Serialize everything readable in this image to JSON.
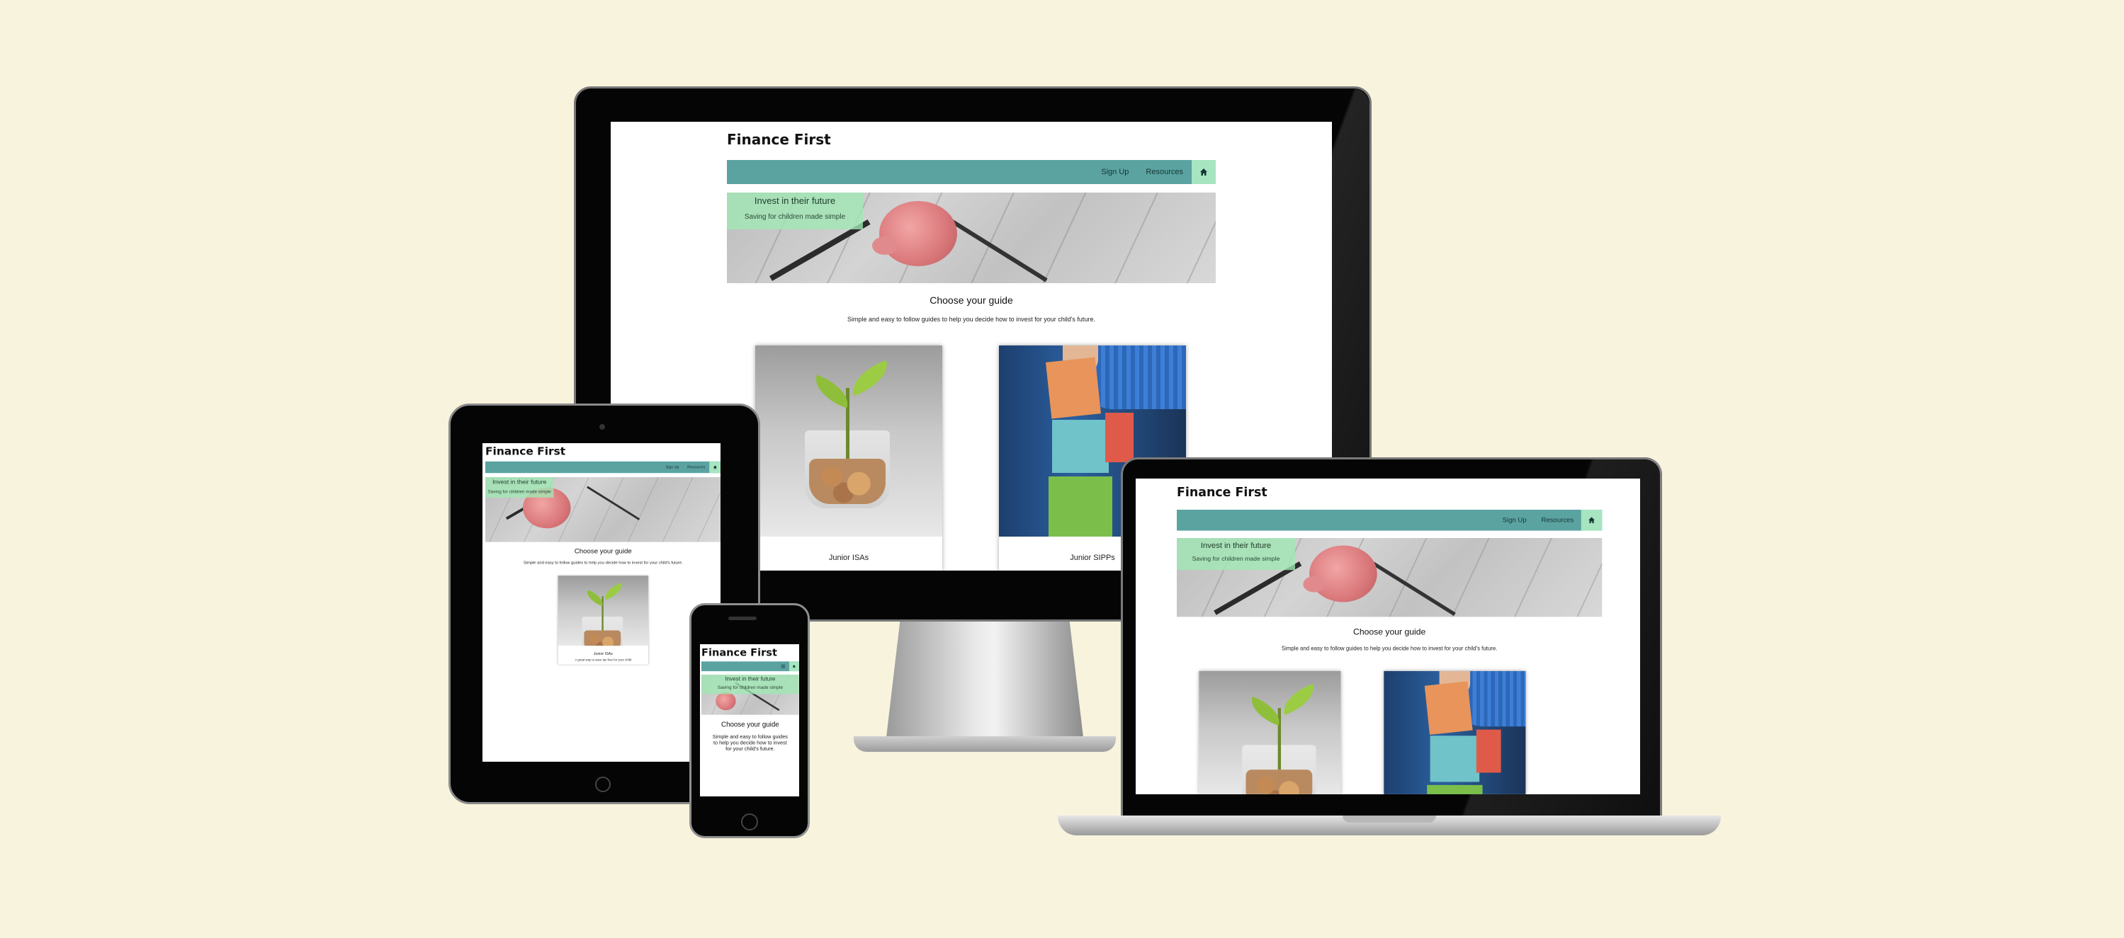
{
  "site": {
    "title": "Finance First",
    "nav": {
      "signup": "Sign Up",
      "resources": "Resources",
      "home_icon": "home-icon",
      "menu_icon": "hamburger-icon"
    },
    "hero": {
      "heading": "Invest in their future",
      "subheading": "Saving for children made simple"
    },
    "section": {
      "title": "Choose your guide",
      "subtitle": "Simple and easy to follow guides to help you decide how to invest for your child's future."
    },
    "cards": [
      {
        "caption": "Junior ISAs",
        "image": "plant-in-coin-jar",
        "body": "A great way to save tax free for your child"
      },
      {
        "caption": "Junior SIPPs",
        "image": "toy-blocks"
      }
    ]
  },
  "colors": {
    "background": "#f8f3dd",
    "nav": "#5aa3a1",
    "accent": "#a6e5c0",
    "bezel": "#050505"
  },
  "devices": [
    "desktop-monitor",
    "tablet",
    "phone",
    "laptop"
  ]
}
